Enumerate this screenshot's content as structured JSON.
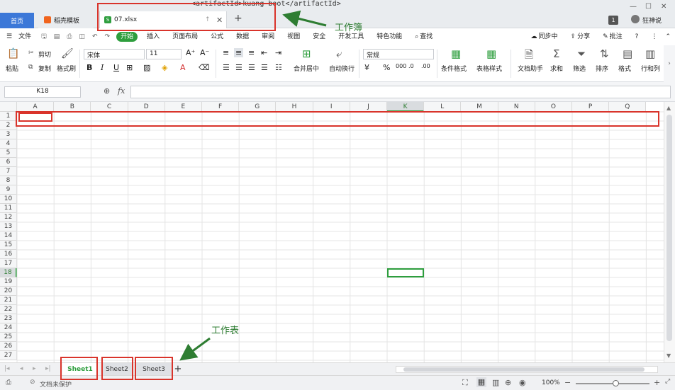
{
  "titlebar": {
    "home_tab": "首页",
    "template_tab": "稻壳模板",
    "file_tab": "07.xlsx",
    "new_tab": "+",
    "badge": "1",
    "user_name": "狂神说",
    "top_text": "<artifactId>kuang-boot</artifactId>"
  },
  "menubar": {
    "file_menu": "文件",
    "tabs": [
      "开始",
      "插入",
      "页面布局",
      "公式",
      "数据",
      "审阅",
      "视图",
      "安全",
      "开发工具",
      "特色功能"
    ],
    "search": "查找",
    "sync": "同步中",
    "share": "分享",
    "comment": "批注",
    "help": "?"
  },
  "ribbon": {
    "paste": "粘贴",
    "cut": "剪切",
    "copy": "复制",
    "format_painter": "格式刷",
    "font_name": "宋体",
    "font_size": "11",
    "bold": "B",
    "italic": "I",
    "underline": "U",
    "merge_center": "合并居中",
    "wrap_text": "自动换行",
    "number_format": "常规",
    "percent": "%",
    "conditional_format": "条件格式",
    "table_style": "表格样式",
    "doc_helper": "文档助手",
    "sum": "求和",
    "filter": "筛选",
    "sort": "排序",
    "format": "格式",
    "row_col": "行和列"
  },
  "formula_bar": {
    "name_box": "K18",
    "fx": "fx"
  },
  "grid": {
    "columns": [
      "A",
      "B",
      "C",
      "D",
      "E",
      "F",
      "G",
      "H",
      "I",
      "J",
      "K",
      "L",
      "M",
      "N",
      "O",
      "P",
      "Q"
    ],
    "rows": [
      "1",
      "2",
      "3",
      "4",
      "5",
      "6",
      "7",
      "8",
      "9",
      "10",
      "11",
      "12",
      "13",
      "14",
      "15",
      "16",
      "17",
      "18",
      "19",
      "20",
      "21",
      "22",
      "23",
      "24",
      "25",
      "26",
      "27"
    ],
    "active_cell": "K18"
  },
  "sheets": {
    "tabs": [
      "Sheet1",
      "Sheet2",
      "Sheet3"
    ],
    "add": "+"
  },
  "status": {
    "doc_state": "文档未保护",
    "zoom": "100%"
  },
  "annotations": {
    "workbook": "工作簿",
    "worksheet": "工作表"
  },
  "colors": {
    "accent_green": "#2e9e3e",
    "home_tab": "#3c78d8",
    "highlight_red": "#d9342b",
    "annotation_green": "#2e7d32"
  }
}
